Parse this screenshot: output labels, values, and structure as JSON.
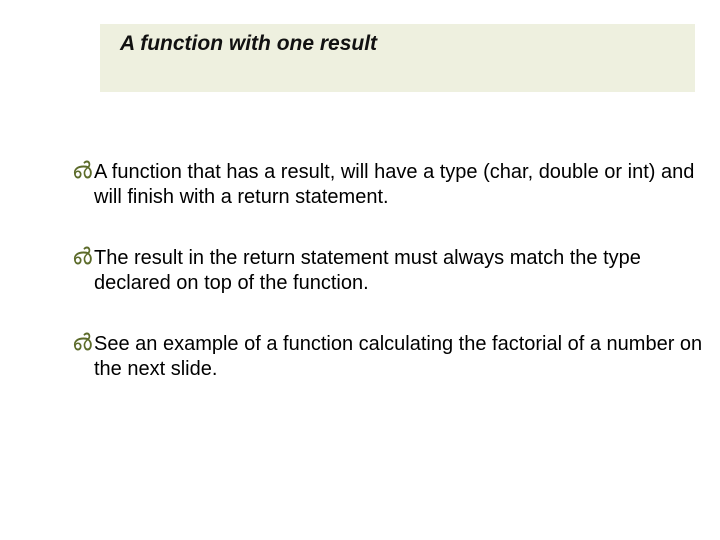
{
  "title": "A function with one result",
  "bullets": {
    "b0": "A function that has a result, will have a type (char, double or int) and will finish with a return statement.",
    "b1": "The result in the return statement must always match the type declared on top of the function.",
    "b2": "See an example of a function calculating the factorial of a number on the next slide."
  },
  "marker_glyph": "൴"
}
